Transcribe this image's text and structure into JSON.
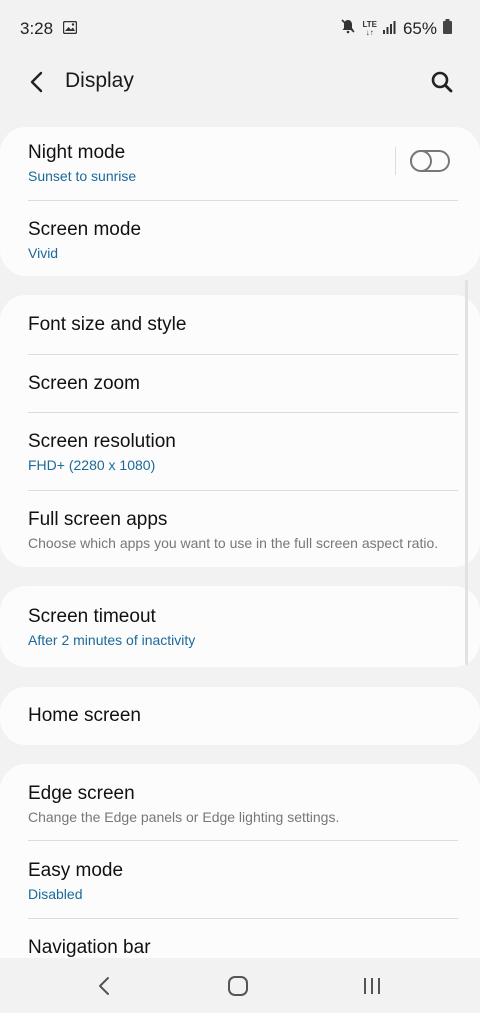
{
  "status_bar": {
    "time": "3:28",
    "battery": "65%",
    "network": "LTE"
  },
  "header": {
    "title": "Display"
  },
  "sections": {
    "night_mode": {
      "title": "Night mode",
      "subtitle": "Sunset to sunrise",
      "toggle_on": false
    },
    "screen_mode": {
      "title": "Screen mode",
      "subtitle": "Vivid"
    },
    "font_size": {
      "title": "Font size and style"
    },
    "screen_zoom": {
      "title": "Screen zoom"
    },
    "screen_resolution": {
      "title": "Screen resolution",
      "subtitle": "FHD+ (2280 x 1080)"
    },
    "full_screen_apps": {
      "title": "Full screen apps",
      "subtitle": "Choose which apps you want to use in the full screen aspect ratio."
    },
    "screen_timeout": {
      "title": "Screen timeout",
      "subtitle": "After 2 minutes of inactivity"
    },
    "home_screen": {
      "title": "Home screen"
    },
    "edge_screen": {
      "title": "Edge screen",
      "subtitle": "Change the Edge panels or Edge lighting settings."
    },
    "easy_mode": {
      "title": "Easy mode",
      "subtitle": "Disabled"
    },
    "navigation_bar": {
      "title": "Navigation bar"
    }
  },
  "colors": {
    "accent": "#1a6a9a",
    "background": "#f2f2f2",
    "card": "#fcfcfc"
  }
}
